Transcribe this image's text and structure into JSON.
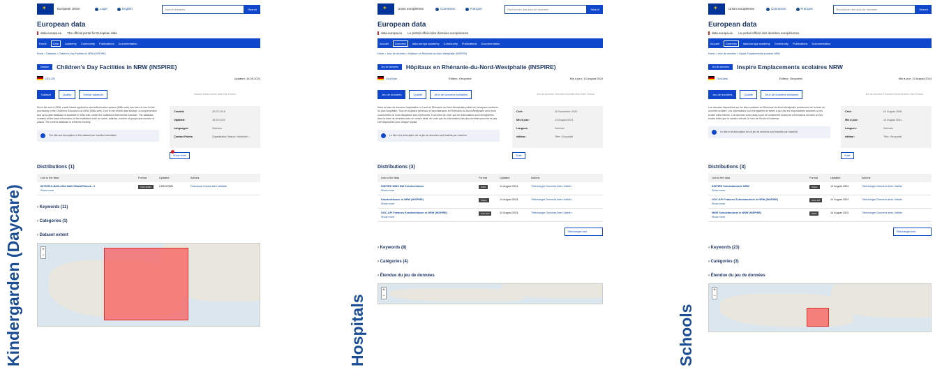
{
  "labels": [
    "Kindergarden (Daycare)",
    "Hospitals",
    "Schools"
  ],
  "panels": [
    {
      "eu_name": "European Union",
      "login": "Login",
      "language": "English",
      "search_placeholder": "Search datasets",
      "search_btn": "Search",
      "portal_title": "European data",
      "portal_url": "data.europa.eu",
      "portal_tagline": "The official portal for European data",
      "nav": [
        "Home",
        "Data",
        "Academy",
        "Community",
        "Publications",
        "Documentation"
      ],
      "breadcrumb": "Home > Datasets > Children's Day Facilities in NRW (INSPIRE)",
      "badge": "Dataset",
      "title": "Children's Day Facilities in NRW (INSPIRE)",
      "org": "GDI-DE",
      "meta_mid": "",
      "meta_updated": "Updated: 15.09.2022",
      "tabs": [
        "Dataset",
        "Quality",
        "Similar datasets"
      ],
      "tab_right": "Dataset feeds  Linked data  Cite  Embed",
      "description": "Since the end of 2008, a web-based application and authorisation system (KiBiz.web) has been in use for the processing of the Children's Education Act NRW (KiBiz.web). Due to the central data storage, a comprehensive and up-to-date database is available in KiBiz.web, which the institutions themselves maintain. The database contains all the basic information of the institutions such as name, address, number of groups and number of places. The current database is retrieved monthly.",
      "info": "The title and description of this dataset are machine translated.",
      "side": [
        {
          "k": "Created:",
          "v": "22.02.2019"
        },
        {
          "k": "Updated:",
          "v": "15.09.2022"
        },
        {
          "k": "Languages:",
          "v": "German"
        },
        {
          "k": "Contact Points:",
          "v": "Organisation Name: Nordrhein-..."
        }
      ],
      "showmore": "Show More",
      "dist_title": "Distributions (1)",
      "table_headers": [
        "Link to the data",
        "Format",
        "Updated",
        "Actions"
      ],
      "rows": [
        {
          "name": "88752510-4b83-4106-9a60-f00a4879bec4---1",
          "more": "Show more",
          "fmt": "UNKNOWN",
          "upd": "UNKNOWN",
          "act": "Download  Linked data  Validate"
        }
      ],
      "download_all": "",
      "acc": [
        "Keywords (11)",
        "Categories (1)",
        "Dataset extent"
      ]
    },
    {
      "eu_name": "Union européenne",
      "login": "Connexion",
      "language": "Français",
      "search_placeholder": "Rechercher des jeux de données",
      "search_btn": "Search",
      "portal_title": "European data",
      "portal_url": "data.europa.eu",
      "portal_tagline": "Le portail officiel des données européennes",
      "nav": [
        "Accueil",
        "Données",
        "data.europa academy",
        "Community",
        "Publications",
        "Documentation"
      ],
      "breadcrumb": "Home > Jeux de données > Hôpitaux en Rhénanie-du-Nord-Westphalie (INSPIRE)",
      "badge": "Jeu de données",
      "title": "Hôpitaux en Rhénanie-du-Nord-Westphalie (INSPIRE)",
      "org": "GovData",
      "meta_mid": "Éditeur: Geoportal",
      "meta_updated": "Mis à jour: 13 August 2024",
      "tabs": [
        "Jeu de données",
        "Qualité",
        "Jeux de données similaires"
      ],
      "tab_right": "Jeu de données Fournies  Données liées  Citer  Embed",
      "description": "Dans la base de données hospitalière, le Land de Rhénanie-du-Nord-Westphalie publie les principaux contenus du plan hospitalier. Tous les hôpitaux généraux et psychiatriques en Rhénanie-du-Nord-Westphalie avec leurs coordonnées et leurs disciplines sont répertoriés. Il convient de noter que les informations sont enregistrées dans la base de données avec un certain délai, de sorte que les informations les plus récentes peuvent ne pas être disponibles pour chaque hôpital.",
      "info": "Le titre et la description de ce jeu de données sont traduits par machine.",
      "side": [
        {
          "k": "Créé:",
          "v": "20 November 2020"
        },
        {
          "k": "Mis à jour:",
          "v": "13 August 2024"
        },
        {
          "k": "Langues:",
          "v": "German"
        },
        {
          "k": "éditeur:",
          "v": "Titre: Geoportal"
        }
      ],
      "showmore": "Suite",
      "dist_title": "Distributions (3)",
      "table_headers": [
        "Link to the data",
        "Format",
        "Updated",
        "Actions"
      ],
      "rows": [
        {
          "name": "INSPIRE-WMS NW Krankenhäuser",
          "more": "Show more",
          "fmt": "WMS",
          "upd": "14 August 2024",
          "act": "Télécharger  Données liées  Valider"
        },
        {
          "name": "Krankenhäuser in NRW (INSPIRE)",
          "more": "Show more",
          "fmt": "Shape",
          "upd": "14 August 2024",
          "act": "Télécharger  Données liées  Valider"
        },
        {
          "name": "OGC-API Features Krankenhäuser in NRW (INSPIRE)",
          "more": "Show more",
          "fmt": "OGC API",
          "upd": "14 August 2024",
          "act": "Télécharger  Données liées  Valider"
        }
      ],
      "download_all": "Téléchargez tout",
      "acc": [
        "Keywords (8)",
        "Catégories (4)",
        "Étendue du jeu de données"
      ]
    },
    {
      "eu_name": "Union européenne",
      "login": "Connexion",
      "language": "Français",
      "search_placeholder": "Rechercher des jeux de données",
      "search_btn": "Search",
      "portal_title": "European data",
      "portal_url": "data.europa.eu",
      "portal_tagline": "Le portail officiel des données européennes",
      "nav": [
        "Accueil",
        "Données",
        "data.europa academy",
        "Community",
        "Publications",
        "Documentation"
      ],
      "breadcrumb": "Home > Jeux de données > Inspire Emplacements scolaires NRW",
      "badge": "Jeu de données",
      "title": "Inspire Emplacements scolaires NRW",
      "org": "GovData",
      "meta_mid": "Éditeur: Geoportal",
      "meta_updated": "Mis à jour: 13 August 2024",
      "tabs": [
        "Jeu de données",
        "Qualité",
        "Jeux de données similaires"
      ],
      "tab_right": "Jeu de données Fournies  Données liées  Citer  Embed",
      "description": "Les données disponibles sur les sites scolaires en Rhénanie-du-Nord-Westphalie proviennent de la base de données scolaire. Les informations sont enregistrées et mises à jour par les responsables scolaires ou les écoles elles-mêmes. Les données sont mises à jour et contiennent toutes les informations de base sur les écoles telles que le numéro d'école, le nom de l'école et l'adresse.",
      "info": "Le titre et la description de ce jeu de données sont traduits par machine.",
      "side": [
        {
          "k": "Créé:",
          "v": "01 August 2008"
        },
        {
          "k": "Mis à jour:",
          "v": "13 August 2024"
        },
        {
          "k": "Langues:",
          "v": "German"
        },
        {
          "k": "éditeur:",
          "v": "Titre: Geoportal"
        }
      ],
      "showmore": "Suite",
      "dist_title": "Distributions (3)",
      "table_headers": [
        "Link to the data",
        "Format",
        "Updated",
        "Actions"
      ],
      "rows": [
        {
          "name": "INSPIRE Schulstandorte NRW",
          "more": "Show more",
          "fmt": "Shape",
          "upd": "14 August 2024",
          "act": "Télécharger  Données liées  Valider"
        },
        {
          "name": "OGC-API Features Schulstandorte in NRW (INSPIRE)",
          "more": "Show more",
          "fmt": "OGC API",
          "upd": "14 August 2024",
          "act": "Télécharger  Données liées  Valider"
        },
        {
          "name": "WMS Schulstandorte in NRW (INSPIRE)",
          "more": "Show more",
          "fmt": "WMS",
          "upd": "14 August 2024",
          "act": "Télécharger  Données liées  Valider"
        }
      ],
      "download_all": "Téléchargez tout",
      "acc": [
        "Keywords (23)",
        "Catégories (3)",
        "Étendue du jeu de données"
      ]
    }
  ]
}
